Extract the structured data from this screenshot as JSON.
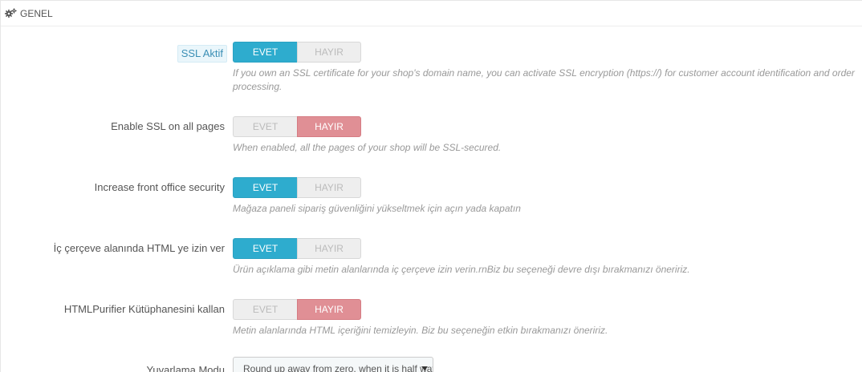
{
  "section": {
    "title": "GENEL",
    "icon": "cogs-icon"
  },
  "settings": [
    {
      "label": "SSL Aktif",
      "yes_label": "EVET",
      "no_label": "HAYIR",
      "value": "EVET",
      "help": "If you own an SSL certificate for your shop's domain name, you can activate SSL encryption (https://) for customer account identification and order processing."
    },
    {
      "label": "Enable SSL on all pages",
      "yes_label": "EVET",
      "no_label": "HAYIR",
      "value": "HAYIR",
      "help": "When enabled, all the pages of your shop will be SSL-secured."
    },
    {
      "label": "Increase front office security",
      "yes_label": "EVET",
      "no_label": "HAYIR",
      "value": "EVET",
      "help": "Mağaza paneli sipariş güvenliğini yükseltmek için açın yada kapatın"
    },
    {
      "label": "İç çerçeve alanında HTML ye izin ver",
      "yes_label": "EVET",
      "no_label": "HAYIR",
      "value": "EVET",
      "help": "Ürün açıklama gibi metin alanlarında iç çerçeve izin verin.rnBiz bu seçeneği devre dışı bırakmanızı öneririz."
    },
    {
      "label": "HTMLPurifier Kütüphanesini kallan",
      "yes_label": "EVET",
      "no_label": "HAYIR",
      "value": "HAYIR",
      "help": "Metin alanlarında HTML içeriğini temizleyin. Biz bu seçeneğin etkin bırakmanızı öneririz."
    }
  ],
  "rounding": {
    "label": "Yuvarlama Modu",
    "selected": "Round up away from zero, when it is half way there (recommended)"
  },
  "colors": {
    "active_yes": "#2eacce",
    "active_no": "#e08f95",
    "inactive": "#eeeeee"
  }
}
